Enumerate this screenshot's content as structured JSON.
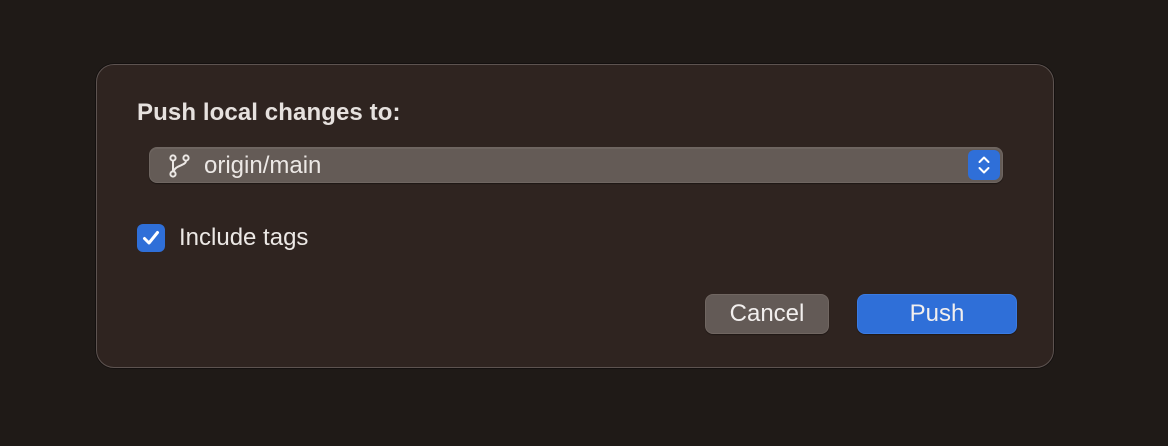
{
  "dialog": {
    "title": "Push local changes to:",
    "remote_select": {
      "value": "origin/main",
      "icon": "git-branch-icon"
    },
    "include_tags": {
      "label": "Include tags",
      "checked": true
    },
    "buttons": {
      "cancel_label": "Cancel",
      "push_label": "Push"
    }
  },
  "colors": {
    "background": "#1f1a17",
    "dialog": "#2f2420",
    "accent": "#2f6fd8",
    "control": "#645b56"
  }
}
